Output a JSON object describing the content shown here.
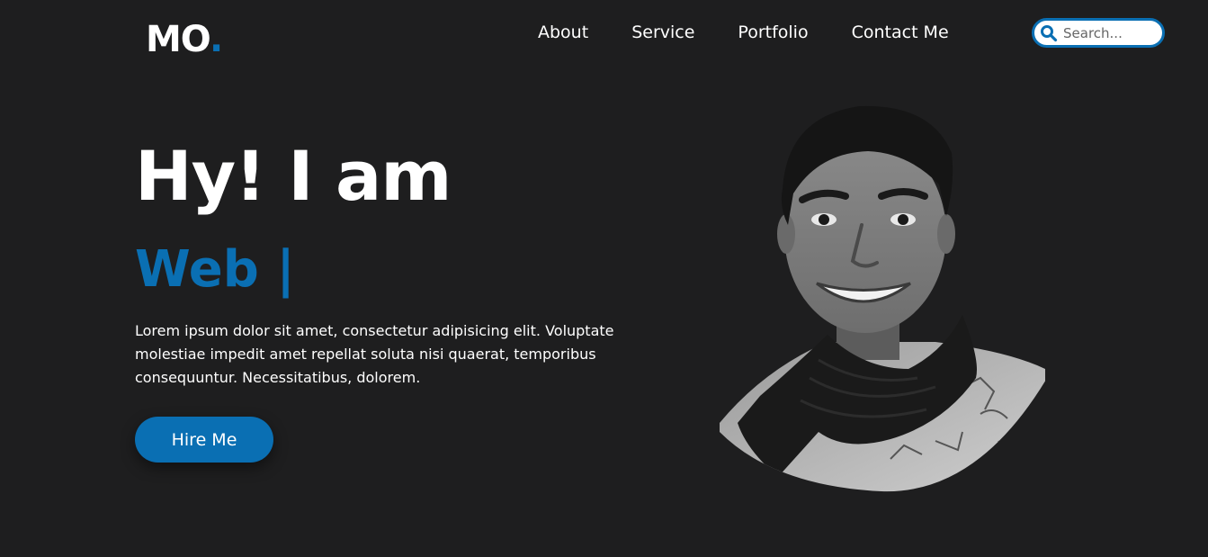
{
  "header": {
    "logo_text": "MO",
    "logo_dot": ".",
    "nav": [
      "About",
      "Service",
      "Portfolio",
      "Contact Me"
    ],
    "search_placeholder": "Search..."
  },
  "hero": {
    "title": "Hy! I am",
    "role": "Web |",
    "description": "Lorem ipsum dolor sit amet, consectetur adipisicing elit. Voluptate molestiae impedit amet repellat soluta nisi quaerat, temporibus consequuntur. Necessitatibus, dolorem.",
    "button": "Hire Me"
  },
  "colors": {
    "accent": "#0a6fb3",
    "background": "#1e1e1f",
    "text": "#ffffff"
  },
  "icons": {
    "search": "search-icon"
  }
}
